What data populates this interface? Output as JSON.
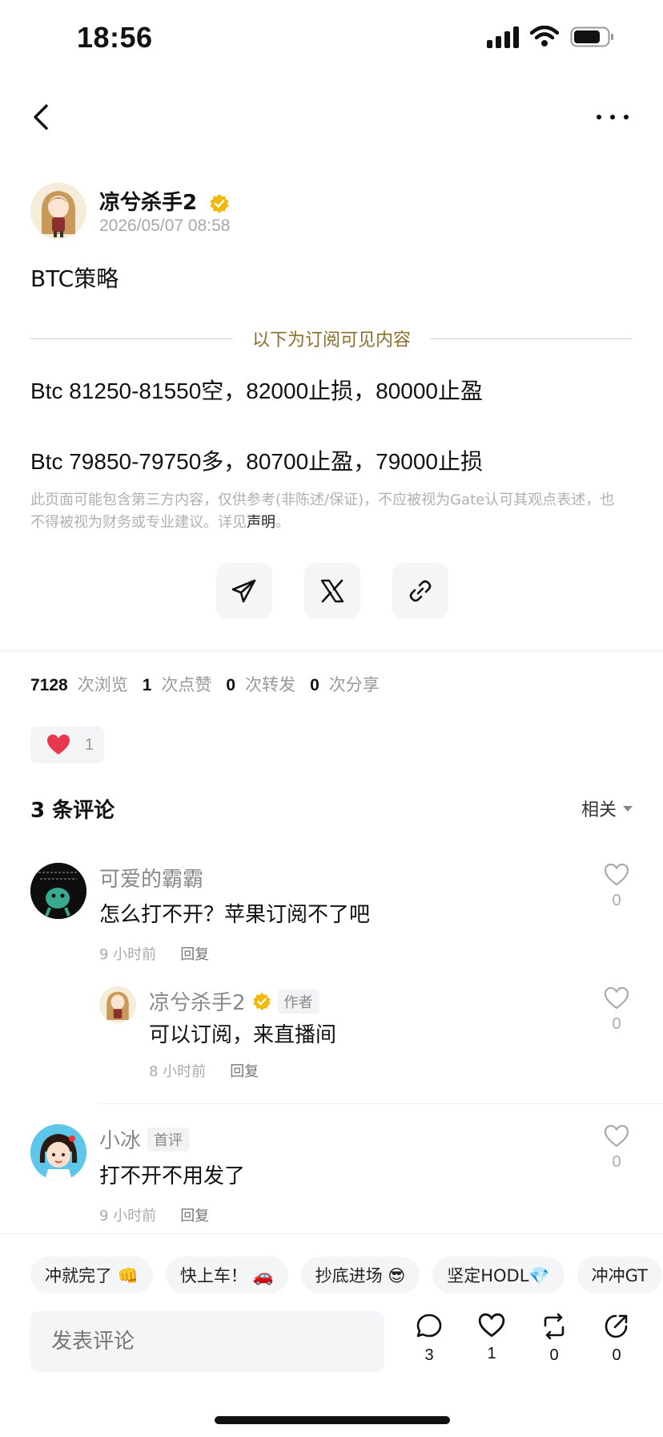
{
  "status_bar": {
    "time": "18:56"
  },
  "post": {
    "author": "凉兮杀手2",
    "time": "2026/05/07 08:58",
    "title": "BTC策略",
    "subscribe_divider": "以下为订阅可见内容",
    "lines": [
      "Btc 81250-81550空，82000止损，80000止盈",
      "Btc 79850-79750多，80700止盈，79000止损"
    ],
    "disclaimer_text": "此页面可能包含第三方内容，仅供参考(非陈述/保证)，不应被视为Gate认可其观点表述，也不得被视为财务或专业建议。详见",
    "disclaimer_link": "声明",
    "disclaimer_end": "。"
  },
  "share": {
    "icons": [
      "telegram-icon",
      "x-icon",
      "link-icon"
    ]
  },
  "stats": {
    "views": "7128",
    "views_label": "次浏览",
    "likes": "1",
    "likes_label": "次点赞",
    "reposts": "0",
    "reposts_label": "次转发",
    "shares": "0",
    "shares_label": "次分享"
  },
  "reaction": {
    "emoji": "heart",
    "count": "1"
  },
  "comments": {
    "title": "3 条评论",
    "sort": "相关",
    "items": [
      {
        "name": "可爱的霸霸",
        "text": "怎么打不开？苹果订阅不了吧",
        "time": "9 小时前",
        "reply": "回复",
        "likes": "0"
      },
      {
        "name": "凉兮杀手2",
        "tag": "作者",
        "text": "可以订阅，来直播间",
        "time": "8 小时前",
        "reply": "回复",
        "likes": "0"
      },
      {
        "name": "小冰",
        "tag": "首评",
        "text": "打不开不用发了",
        "time": "9 小时前",
        "reply": "回复",
        "likes": "0"
      }
    ]
  },
  "quick_replies": [
    "冲就完了 👊",
    "快上车！ 🚗",
    "抄底进场 😎",
    "坚定HODL💎",
    "冲冲GT"
  ],
  "input": {
    "placeholder": "发表评论"
  },
  "actions": {
    "comments": "3",
    "likes": "1",
    "reposts": "0",
    "shares": "0"
  },
  "colors": {
    "accent_gold": "#8c6e2c",
    "verified": "#f0b90b",
    "like_red": "#e8384f"
  }
}
